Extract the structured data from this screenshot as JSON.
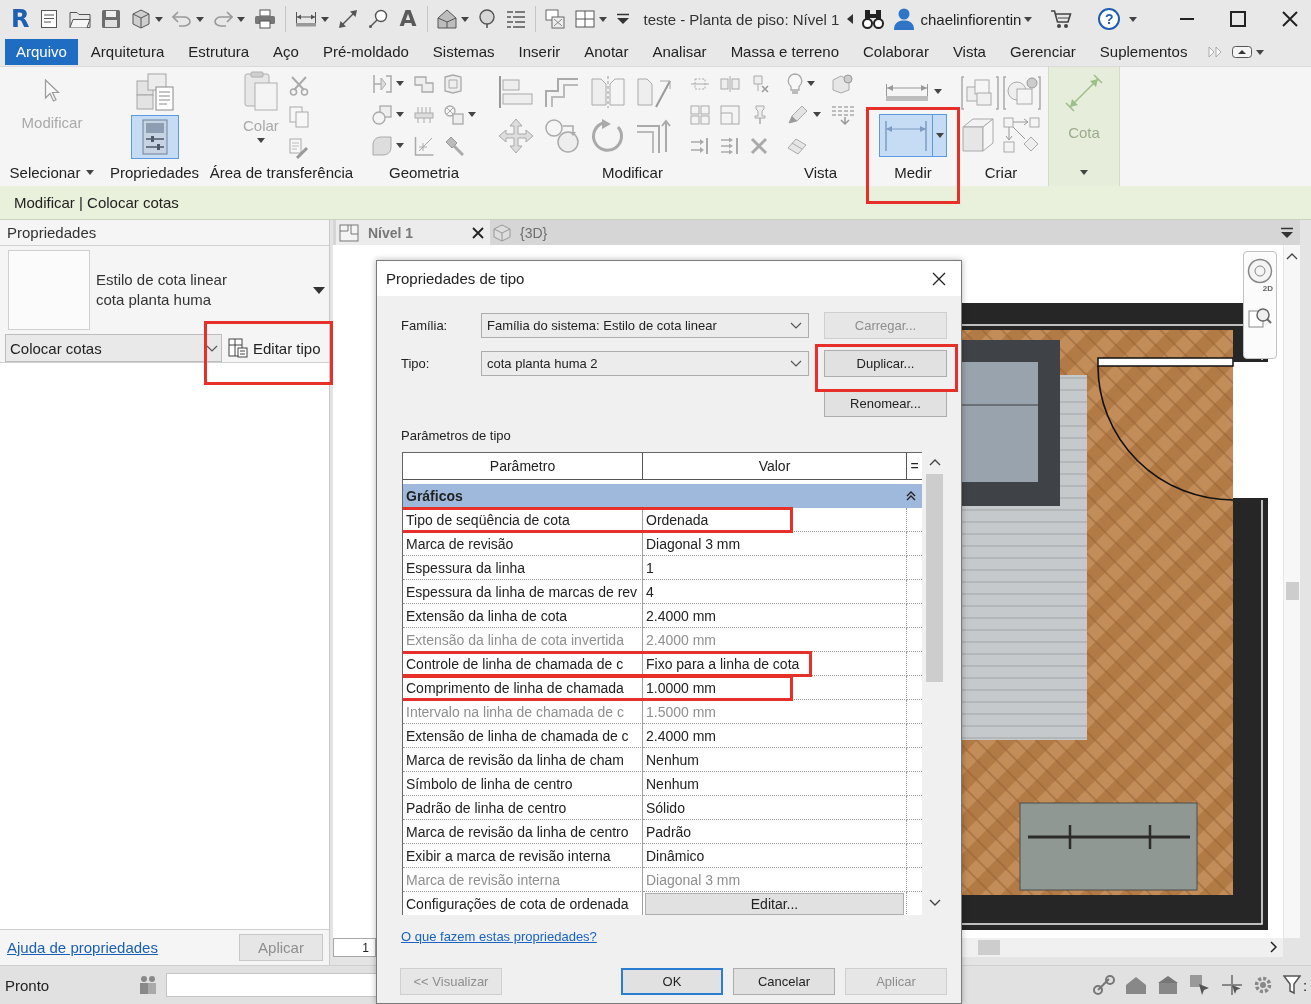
{
  "app": {
    "logo": "R",
    "text_tool": "A",
    "title": "teste - Planta de piso: Nível 1",
    "user": "chaelinfiorentin",
    "help": "?"
  },
  "menu_tabs": [
    {
      "label": "Arquivo",
      "selected": true
    },
    {
      "label": "Arquitetura",
      "selected": false
    },
    {
      "label": "Estrutura",
      "selected": false
    },
    {
      "label": "Aço",
      "selected": false
    },
    {
      "label": "Pré-moldado",
      "selected": false
    },
    {
      "label": "Sistemas",
      "selected": false
    },
    {
      "label": "Inserir",
      "selected": false
    },
    {
      "label": "Anotar",
      "selected": false
    },
    {
      "label": "Analisar",
      "selected": false
    },
    {
      "label": "Massa e terreno",
      "selected": false
    },
    {
      "label": "Colaborar",
      "selected": false
    },
    {
      "label": "Vista",
      "selected": false
    },
    {
      "label": "Gerenciar",
      "selected": false
    },
    {
      "label": "Suplementos",
      "selected": false
    }
  ],
  "ribbon": {
    "panels": [
      {
        "kind": "select",
        "label": "Selecionar",
        "dropdown": true,
        "contextual": false,
        "highlighted": false,
        "tools": [
          {
            "label": "Modificar",
            "disabled": true
          }
        ]
      },
      {
        "kind": "properties",
        "label": "Propriedades",
        "dropdown": false,
        "contextual": false,
        "highlighted": false,
        "tools": [
          {
            "selected": false
          },
          {
            "selected": true
          }
        ]
      },
      {
        "kind": "clipboard",
        "label": "Área de transferência",
        "dropdown": false,
        "contextual": false,
        "highlighted": false,
        "tools": [
          {
            "label": "Colar",
            "disabled": true
          }
        ]
      },
      {
        "kind": "geometry",
        "label": "Geometria",
        "dropdown": false,
        "contextual": false,
        "highlighted": false
      },
      {
        "kind": "modify",
        "label": "Modificar",
        "dropdown": false,
        "contextual": false,
        "highlighted": false
      },
      {
        "kind": "view",
        "label": "Vista",
        "dropdown": false,
        "contextual": false,
        "highlighted": false
      },
      {
        "kind": "measure",
        "label": "Medir",
        "dropdown": false,
        "contextual": false,
        "highlighted": true,
        "tools": [
          {
            "selected": true
          }
        ]
      },
      {
        "kind": "create",
        "label": "Criar",
        "dropdown": false,
        "contextual": false,
        "highlighted": false
      },
      {
        "kind": "dimension",
        "dropdown": true,
        "contextual": true,
        "highlighted": false,
        "tools": [
          {
            "label": "Cota",
            "disabled": true
          }
        ]
      }
    ]
  },
  "context_bar": {
    "title": "Modificar | Colocar cotas"
  },
  "properties_panel": {
    "title": "Propriedades",
    "type_selector": {
      "family": "Estilo de cota linear",
      "name": "cota planta huma"
    },
    "filter": "Colocar cotas",
    "edit_type": {
      "label": "Editar tipo",
      "highlighted": true
    },
    "help_link": "Ajuda de propriedades",
    "apply": {
      "label": "Aplicar",
      "disabled": true
    }
  },
  "view": {
    "tabs": [
      {
        "label": "Nível 1",
        "kind": "plan",
        "selected": true
      },
      {
        "label": "{3D}",
        "kind": "model",
        "selected": false
      }
    ],
    "nav_label": "2D",
    "scale": "1"
  },
  "dialog": {
    "title": "Propriedades de tipo",
    "family": {
      "label": "Família:",
      "value": "Família do sistema: Estilo de cota linear"
    },
    "type": {
      "label": "Tipo:",
      "value": "cota planta huma 2"
    },
    "side_buttons": [
      {
        "label": "Carregar...",
        "disabled": true,
        "highlighted": false
      },
      {
        "label": "Duplicar...",
        "disabled": false,
        "highlighted": true
      },
      {
        "label": "Renomear...",
        "disabled": false,
        "highlighted": false
      }
    ],
    "params_label": "Parâmetros de tipo",
    "columns": [
      "Parâmetro",
      "Valor",
      "="
    ],
    "groups": [
      {
        "name": "Gráficos",
        "expanded": true,
        "rows": [
          {
            "parameter": "Tipo de seqüência de cota",
            "value": "Ordenada",
            "kind": "text",
            "disabled": false,
            "highlighted": true
          },
          {
            "parameter": "Marca de revisão",
            "value": "Diagonal 3 mm",
            "kind": "text",
            "disabled": false,
            "highlighted": false
          },
          {
            "parameter": "Espessura da linha",
            "value": "1",
            "kind": "text",
            "disabled": false,
            "highlighted": false
          },
          {
            "parameter": "Espessura da linha de marcas de rev",
            "value": "4",
            "kind": "text",
            "disabled": false,
            "highlighted": false
          },
          {
            "parameter": "Extensão da linha de cota",
            "value": "2.4000 mm",
            "kind": "text",
            "disabled": false,
            "highlighted": false
          },
          {
            "parameter": "Extensão da linha de cota invertida",
            "value": "2.4000 mm",
            "kind": "text",
            "disabled": true,
            "highlighted": false
          },
          {
            "parameter": "Controle de linha de chamada de c",
            "value": "Fixo para a linha de cota",
            "kind": "text",
            "disabled": false,
            "highlighted": true
          },
          {
            "parameter": "Comprimento de linha de chamada",
            "value": "1.0000 mm",
            "kind": "text",
            "disabled": false,
            "highlighted": true
          },
          {
            "parameter": "Intervalo na linha de chamada de c",
            "value": "1.5000 mm",
            "kind": "text",
            "disabled": true,
            "highlighted": false
          },
          {
            "parameter": "Extensão de linha de chamada de c",
            "value": "2.4000 mm",
            "kind": "text",
            "disabled": false,
            "highlighted": false
          },
          {
            "parameter": "Marca de revisão da linha de cham",
            "value": "Nenhum",
            "kind": "text",
            "disabled": false,
            "highlighted": false
          },
          {
            "parameter": "Símbolo de linha de centro",
            "value": "Nenhum",
            "kind": "text",
            "disabled": false,
            "highlighted": false
          },
          {
            "parameter": "Padrão de linha de centro",
            "value": "Sólido",
            "kind": "text",
            "disabled": false,
            "highlighted": false
          },
          {
            "parameter": "Marca de revisão da linha de centro",
            "value": "Padrão",
            "kind": "text",
            "disabled": false,
            "highlighted": false
          },
          {
            "parameter": "Exibir a marca de revisão interna",
            "value": "Dinâmico",
            "kind": "text",
            "disabled": false,
            "highlighted": false
          },
          {
            "parameter": "Marca de revisão interna",
            "value": "Diagonal 3 mm",
            "kind": "text",
            "disabled": true,
            "highlighted": false
          },
          {
            "parameter": "Configurações de cota de ordenada",
            "value": "Editar...",
            "kind": "button",
            "disabled": false,
            "highlighted": false
          }
        ]
      }
    ],
    "help_link": "O que fazem estas propriedades?",
    "buttons": [
      {
        "label": "<< Visualizar",
        "disabled": true,
        "default": false
      },
      {
        "label": "OK",
        "disabled": false,
        "default": true
      },
      {
        "label": "Cancelar",
        "disabled": false,
        "default": false
      },
      {
        "label": "Aplicar",
        "disabled": true,
        "default": false
      }
    ]
  },
  "status_bar": {
    "text": "Pronto",
    "filter_count": ":"
  }
}
